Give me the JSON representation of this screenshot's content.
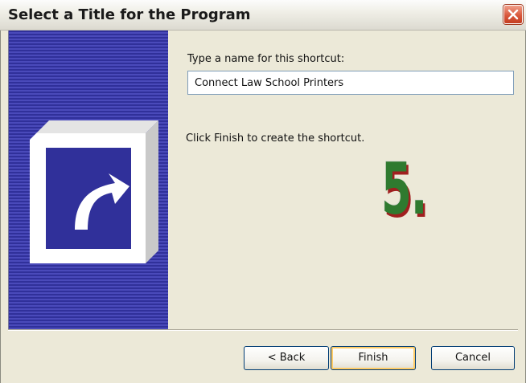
{
  "window": {
    "title": "Select a Title for the Program",
    "close_icon": "close-icon"
  },
  "banner": {
    "icon": "shortcut-arrow-icon",
    "colors": {
      "dark": "#30309a",
      "light": "#4a4aba"
    }
  },
  "form": {
    "name_label": "Type a name for this shortcut:",
    "name_value": "Connect Law School Printers",
    "finish_hint": "Click Finish to create the shortcut."
  },
  "annotation": {
    "step": "5."
  },
  "buttons": {
    "back": "< Back",
    "finish": "Finish",
    "cancel": "Cancel"
  }
}
